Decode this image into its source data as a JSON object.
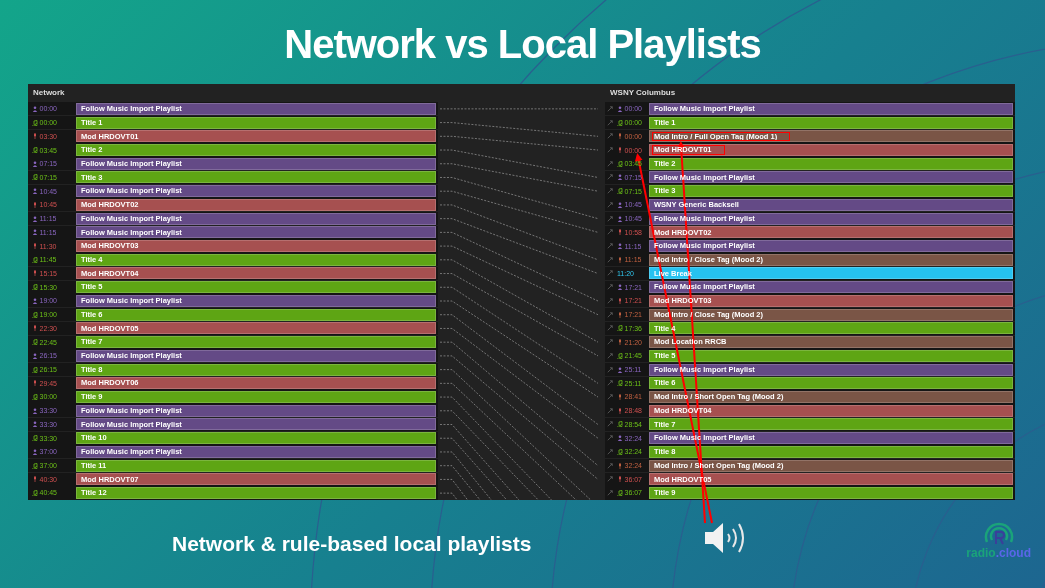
{
  "slide": {
    "title": "Network vs Local Playlists",
    "caption": "Network & rule-based local playlists",
    "logo": [
      "radio",
      ".cloud"
    ]
  },
  "network": {
    "title": "Network",
    "rows": [
      {
        "kind": "playlist",
        "time": "00:00",
        "label": "Follow Music Import Playlist"
      },
      {
        "kind": "song",
        "time": "00:00",
        "label": "Title 1"
      },
      {
        "kind": "mod",
        "time": "03:30",
        "label": "Mod HRDOVT01"
      },
      {
        "kind": "song",
        "time": "03:45",
        "label": "Title 2"
      },
      {
        "kind": "playlist",
        "time": "07:15",
        "label": "Follow Music Import Playlist"
      },
      {
        "kind": "song",
        "time": "07:15",
        "label": "Title 3"
      },
      {
        "kind": "playlist",
        "time": "10:45",
        "label": "Follow Music Import Playlist"
      },
      {
        "kind": "mod",
        "time": "10:45",
        "label": "Mod HRDOVT02"
      },
      {
        "kind": "playlist",
        "time": "11:15",
        "label": "Follow Music Import Playlist"
      },
      {
        "kind": "playlist",
        "time": "11:15",
        "label": "Follow Music Import Playlist"
      },
      {
        "kind": "mod",
        "time": "11:30",
        "label": "Mod HRDOVT03"
      },
      {
        "kind": "song",
        "time": "11:45",
        "label": "Title 4"
      },
      {
        "kind": "mod",
        "time": "15:15",
        "label": "Mod HRDOVT04"
      },
      {
        "kind": "song",
        "time": "15:30",
        "label": "Title 5"
      },
      {
        "kind": "playlist",
        "time": "19:00",
        "label": "Follow Music Import Playlist"
      },
      {
        "kind": "song",
        "time": "19:00",
        "label": "Title 6"
      },
      {
        "kind": "mod",
        "time": "22:30",
        "label": "Mod HRDOVT05"
      },
      {
        "kind": "song",
        "time": "22:45",
        "label": "Title 7"
      },
      {
        "kind": "playlist",
        "time": "26:15",
        "label": "Follow Music Import Playlist"
      },
      {
        "kind": "song",
        "time": "26:15",
        "label": "Title 8"
      },
      {
        "kind": "mod",
        "time": "29:45",
        "label": "Mod HRDOVT06"
      },
      {
        "kind": "song",
        "time": "30:00",
        "label": "Title 9"
      },
      {
        "kind": "playlist",
        "time": "33:30",
        "label": "Follow Music Import Playlist"
      },
      {
        "kind": "playlist",
        "time": "33:30",
        "label": "Follow Music Import Playlist"
      },
      {
        "kind": "song",
        "time": "33:30",
        "label": "Title 10"
      },
      {
        "kind": "playlist",
        "time": "37:00",
        "label": "Follow Music Import Playlist"
      },
      {
        "kind": "song",
        "time": "37:00",
        "label": "Title 11"
      },
      {
        "kind": "mod",
        "time": "40:30",
        "label": "Mod HRDOVT07"
      },
      {
        "kind": "song",
        "time": "40:45",
        "label": "Title 12"
      }
    ]
  },
  "local": {
    "title": "WSNY Columbus",
    "rows": [
      {
        "kind": "playlist",
        "time": "00:00",
        "label": "Follow Music Import Playlist",
        "highlighted": false
      },
      {
        "kind": "song",
        "time": "00:00",
        "label": "Title 1",
        "highlighted": false
      },
      {
        "kind": "voice",
        "time": "00:00",
        "label": "Mod Intro / Full Open Tag (Mood 1)",
        "highlighted": true
      },
      {
        "kind": "mod",
        "time": "00:00",
        "label": "Mod HRDOVT01",
        "highlighted": true
      },
      {
        "kind": "song",
        "time": "03:45",
        "label": "Title 2",
        "highlighted": false
      },
      {
        "kind": "playlist",
        "time": "07:15",
        "label": "Follow Music Import Playlist",
        "highlighted": false
      },
      {
        "kind": "song",
        "time": "07:15",
        "label": "Title 3",
        "highlighted": false
      },
      {
        "kind": "playlist",
        "time": "10:45",
        "label": "WSNY Generic Backsell",
        "highlighted": false
      },
      {
        "kind": "playlist",
        "time": "10:45",
        "label": "Follow Music Import Playlist",
        "highlighted": false
      },
      {
        "kind": "mod",
        "time": "10:58",
        "label": "Mod HRDOVT02",
        "highlighted": false
      },
      {
        "kind": "playlist",
        "time": "11:15",
        "label": "Follow Music Import Playlist",
        "highlighted": false
      },
      {
        "kind": "voice",
        "time": "11:15",
        "label": "Mod Intro / Close Tag (Mood 2)",
        "highlighted": false
      },
      {
        "kind": "live",
        "time": "11:20",
        "label": "Live Break",
        "highlighted": false
      },
      {
        "kind": "playlist",
        "time": "17:21",
        "label": "Follow Music Import Playlist",
        "highlighted": false
      },
      {
        "kind": "mod",
        "time": "17:21",
        "label": "Mod HRDOVT03",
        "highlighted": false
      },
      {
        "kind": "voice",
        "time": "17:21",
        "label": "Mod Intro / Close Tag (Mood 2)",
        "highlighted": false
      },
      {
        "kind": "song",
        "time": "17:36",
        "label": "Title 4",
        "highlighted": false
      },
      {
        "kind": "voice",
        "time": "21:20",
        "label": "Mod Location RRCB",
        "highlighted": false
      },
      {
        "kind": "song",
        "time": "21:45",
        "label": "Title 5",
        "highlighted": false
      },
      {
        "kind": "playlist",
        "time": "25:11",
        "label": "Follow Music Import Playlist",
        "highlighted": false
      },
      {
        "kind": "song",
        "time": "25:11",
        "label": "Title 6",
        "highlighted": false
      },
      {
        "kind": "voice",
        "time": "28:41",
        "label": "Mod Intro / Short Open Tag (Mood 2)",
        "highlighted": false
      },
      {
        "kind": "mod",
        "time": "28:48",
        "label": "Mod HRDOVT04",
        "highlighted": false
      },
      {
        "kind": "song",
        "time": "28:54",
        "label": "Title 7",
        "highlighted": false
      },
      {
        "kind": "playlist",
        "time": "32:24",
        "label": "Follow Music Import Playlist",
        "highlighted": false
      },
      {
        "kind": "song",
        "time": "32:24",
        "label": "Title 8",
        "highlighted": false
      },
      {
        "kind": "voice",
        "time": "32:24",
        "label": "Mod Intro / Short Open Tag (Mood 2)",
        "highlighted": false
      },
      {
        "kind": "mod",
        "time": "36:07",
        "label": "Mod HRDOVT05",
        "highlighted": false
      },
      {
        "kind": "song",
        "time": "36:07",
        "label": "Title 9",
        "highlighted": false
      }
    ]
  }
}
